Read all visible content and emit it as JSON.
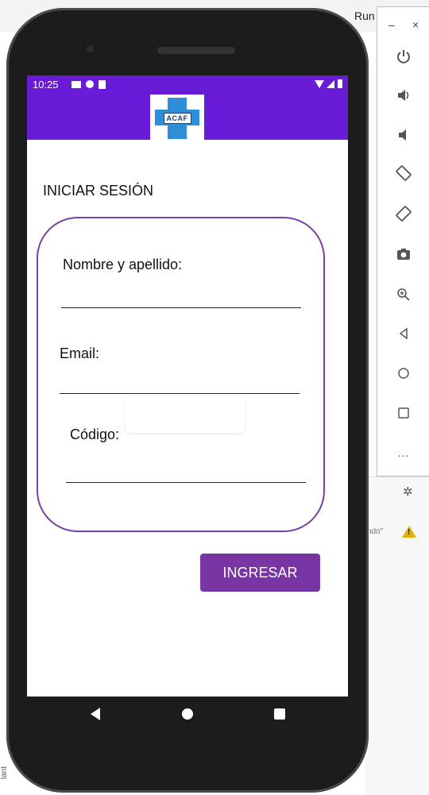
{
  "ide": {
    "run_label": "Run",
    "side_fragment": "ndo\"",
    "warning_symbol": "!",
    "left_vertical_text": "lant"
  },
  "emulator_toolbar": {
    "minimize_symbol": "–",
    "close_symbol": "×",
    "buttons": [
      "power-icon",
      "volume-up-icon",
      "volume-down-icon",
      "rotate-left-icon",
      "rotate-right-icon",
      "camera-icon",
      "zoom-icon",
      "back-icon",
      "home-icon",
      "overview-icon",
      "more-icon"
    ],
    "more_symbol": "..."
  },
  "status_bar": {
    "time": "10:25"
  },
  "app": {
    "logo_text": "ACAF",
    "title": "INICIAR SESIÓN",
    "fields": [
      {
        "label": "Nombre y apellido:",
        "value": ""
      },
      {
        "label": "Email:",
        "value": ""
      },
      {
        "label": "Código:",
        "value": ""
      }
    ],
    "submit_label": "INGRESAR"
  },
  "colors": {
    "primary": "#6a1bd8",
    "button": "#7a35a4",
    "card_border": "#7b3fa6",
    "logo_blue": "#2e8ed7"
  }
}
